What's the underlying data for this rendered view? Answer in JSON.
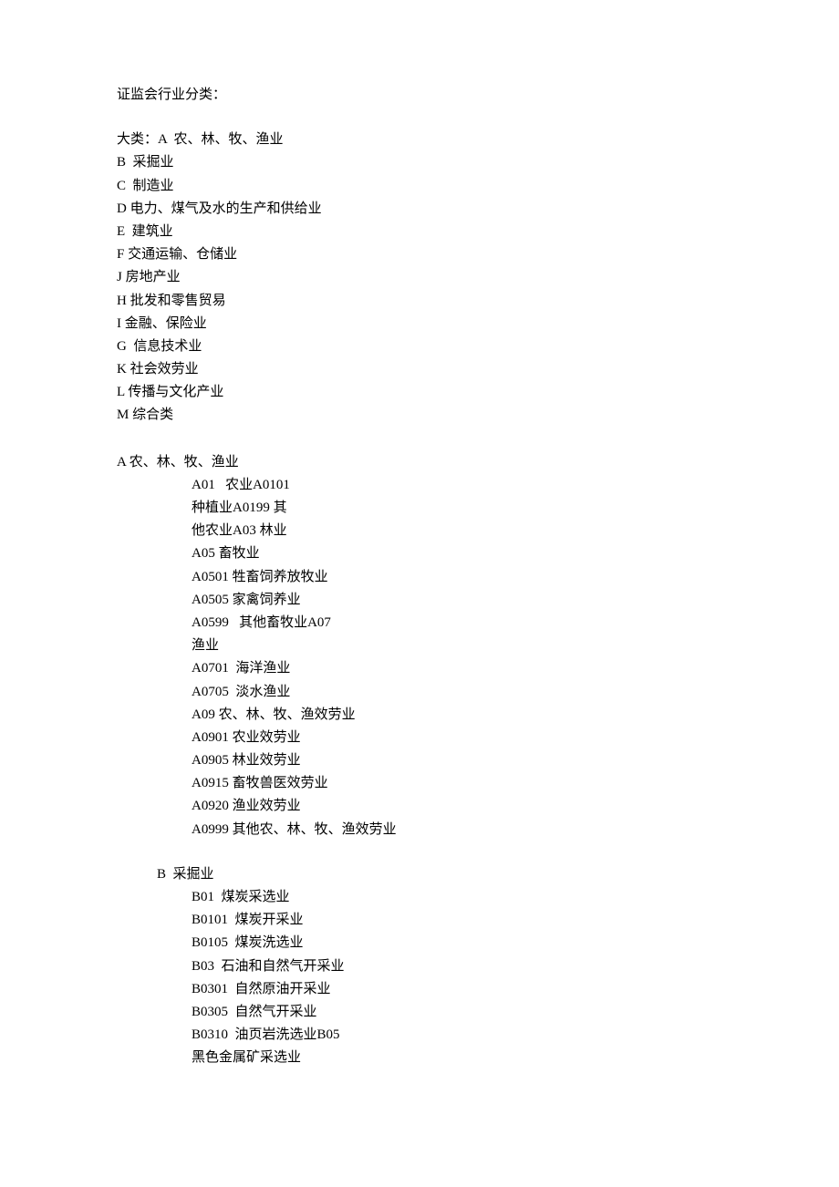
{
  "title": "证监会行业分类：",
  "major": {
    "heading_prefix": "大类：",
    "items": [
      "A  农、林、牧、渔业",
      "B  采掘业",
      "C  制造业",
      "D 电力、煤气及水的生产和供给业",
      "E  建筑业",
      "F 交通运输、仓储业",
      "J 房地产业",
      "H 批发和零售贸易",
      "I 金融、保险业",
      "G  信息技术业",
      "K 社会效劳业",
      "L 传播与文化产业",
      "M 综合类"
    ]
  },
  "sectionA": {
    "header": "A 农、林、牧、渔业",
    "lines": [
      "A01   农业A0101",
      "种植业A0199 其",
      "他农业A03 林业",
      "A05 畜牧业",
      "A0501 牲畜饲养放牧业",
      "A0505 家禽饲养业",
      "A0599   其他畜牧业A07",
      "渔业",
      "A0701  海洋渔业",
      "A0705  淡水渔业",
      "A09 农、林、牧、渔效劳业",
      "A0901 农业效劳业",
      "A0905 林业效劳业",
      "A0915 畜牧兽医效劳业",
      "A0920 渔业效劳业",
      "A0999 其他农、林、牧、渔效劳业"
    ]
  },
  "sectionB": {
    "header": "B  采掘业",
    "lines": [
      "B01  煤炭采选业",
      "B0101  煤炭开采业",
      "B0105  煤炭洗选业",
      "B03  石油和自然气开采业",
      "B0301  自然原油开采业",
      "B0305  自然气开采业",
      "B0310  油页岩洗选业B05",
      "黑色金属矿采选业"
    ]
  }
}
